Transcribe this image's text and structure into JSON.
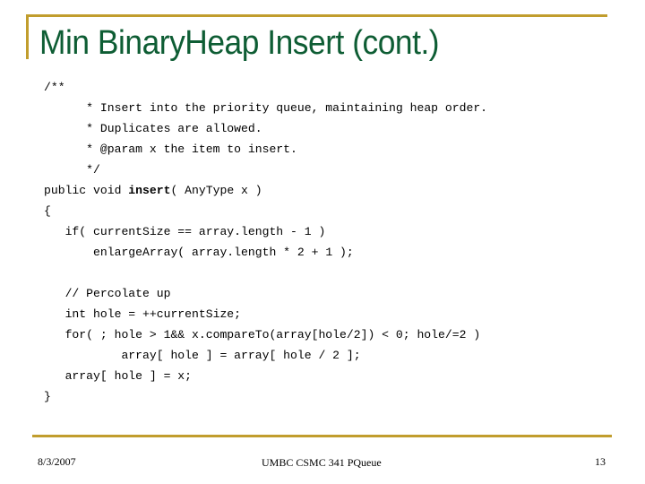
{
  "slide": {
    "title": "Min BinaryHeap Insert (cont.)",
    "code": {
      "lines": [
        {
          "indent": "",
          "pre": "/**",
          "bold": "",
          "post": ""
        },
        {
          "indent": "      ",
          "pre": "* Insert into the priority queue, maintaining heap order.",
          "bold": "",
          "post": ""
        },
        {
          "indent": "      ",
          "pre": "* Duplicates are allowed.",
          "bold": "",
          "post": ""
        },
        {
          "indent": "      ",
          "pre": "* @param x the item to insert.",
          "bold": "",
          "post": ""
        },
        {
          "indent": "      ",
          "pre": "*/",
          "bold": "",
          "post": ""
        },
        {
          "indent": "",
          "pre": "public void ",
          "bold": "insert",
          "post": "( AnyType x )"
        },
        {
          "indent": "",
          "pre": "{",
          "bold": "",
          "post": ""
        },
        {
          "indent": "   ",
          "pre": "if( currentSize == array.length - 1 )",
          "bold": "",
          "post": ""
        },
        {
          "indent": "       ",
          "pre": "enlargeArray( array.length * 2 + 1 );",
          "bold": "",
          "post": ""
        },
        {
          "indent": "",
          "pre": "",
          "bold": "",
          "post": ""
        },
        {
          "indent": "   ",
          "pre": "// Percolate up",
          "bold": "",
          "post": ""
        },
        {
          "indent": "   ",
          "pre": "int hole = ++currentSize;",
          "bold": "",
          "post": ""
        },
        {
          "indent": "   ",
          "pre": "for( ; hole > 1&& x.compareTo(array[hole/2]) < 0; hole/=2 )",
          "bold": "",
          "post": ""
        },
        {
          "indent": "           ",
          "pre": "array[ hole ] = array[ hole / 2 ];",
          "bold": "",
          "post": ""
        },
        {
          "indent": "   ",
          "pre": "array[ hole ] = x;",
          "bold": "",
          "post": ""
        },
        {
          "indent": "",
          "pre": "}",
          "bold": "",
          "post": ""
        }
      ]
    },
    "footer": {
      "date": "8/3/2007",
      "center": "UMBC CSMC 341 PQueue",
      "page_number": "13"
    },
    "colors": {
      "title": "#0e5d34",
      "frame": "#c19d2d"
    }
  }
}
